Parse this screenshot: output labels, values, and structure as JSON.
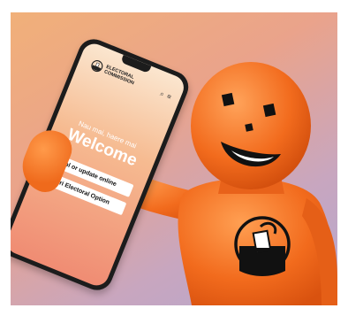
{
  "phone": {
    "status": {
      "time": "",
      "signal": ""
    },
    "logo": {
      "line1": "ELECTORAL",
      "line2": "COMMISSION",
      "line3": ""
    },
    "greeting": "Nau mai, haere mai",
    "welcome": "Welcome",
    "buttons": [
      {
        "label": "Enrol or update online"
      },
      {
        "label": "Māori Electoral Option"
      }
    ],
    "icons": [
      "search-icon",
      "menu-icon"
    ]
  },
  "colors": {
    "figure_orange": "#f26b1d",
    "bg_top": "#f1b079",
    "bg_bottom": "#b4a8cf",
    "phone_black": "#1c1c1c"
  }
}
